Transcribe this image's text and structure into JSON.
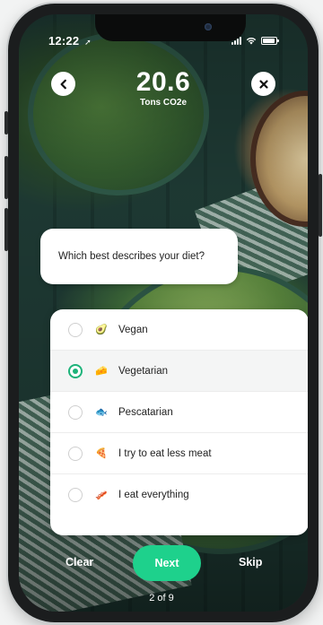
{
  "status": {
    "time": "12:22"
  },
  "header": {
    "score_value": "20.6",
    "score_unit": "Tons CO2e",
    "back_icon": "chevron-left-icon",
    "close_icon": "close-icon"
  },
  "question": {
    "text": "Which best describes your diet?"
  },
  "options": [
    {
      "label": "Vegan",
      "emoji": "🥑",
      "selected": false
    },
    {
      "label": "Vegetarian",
      "emoji": "🧀",
      "selected": true
    },
    {
      "label": "Pescatarian",
      "emoji": "🐟",
      "selected": false
    },
    {
      "label": "I try to eat less meat",
      "emoji": "🍕",
      "selected": false
    },
    {
      "label": "I eat everything",
      "emoji": "🥓",
      "selected": false
    }
  ],
  "actions": {
    "clear": "Clear",
    "next": "Next",
    "skip": "Skip"
  },
  "progress": {
    "label": "2 of 9"
  },
  "colors": {
    "accent": "#1ed18c",
    "selected_radio": "#1db37a"
  }
}
